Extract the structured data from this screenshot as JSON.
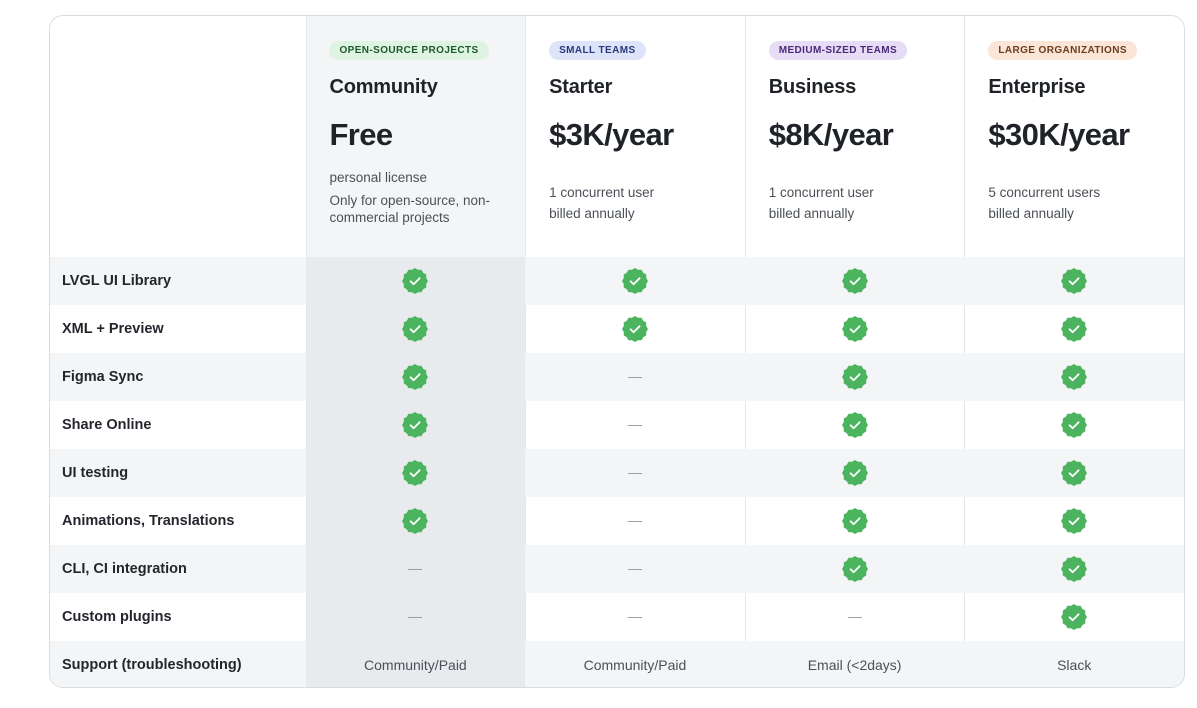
{
  "plans": [
    {
      "badge": "OPEN-SOURCE PROJECTS",
      "badge_bg": "#dff3e3",
      "badge_fg": "#1c5a2c",
      "name": "Community",
      "price": "Free",
      "desc_line1": "personal license",
      "desc_line2": "",
      "note": "Only for open-source, non-commercial projects"
    },
    {
      "badge": "SMALL TEAMS",
      "badge_bg": "#dde3f8",
      "badge_fg": "#2a3a7a",
      "name": "Starter",
      "price": "$3K/year",
      "desc_line1": "1 concurrent user",
      "desc_line2": "billed annually",
      "note": ""
    },
    {
      "badge": "MEDIUM-SIZED TEAMS",
      "badge_bg": "#e6dcf6",
      "badge_fg": "#4a2a78",
      "name": "Business",
      "price": "$8K/year",
      "desc_line1": "1 concurrent user",
      "desc_line2": "billed annually",
      "note": ""
    },
    {
      "badge": "LARGE ORGANIZATIONS",
      "badge_bg": "#fae5d6",
      "badge_fg": "#6b3d1c",
      "name": "Enterprise",
      "price": "$30K/year",
      "desc_line1": "5 concurrent users",
      "desc_line2": "billed annually",
      "note": ""
    }
  ],
  "features": [
    {
      "label": "LVGL UI Library",
      "values": [
        "check",
        "check",
        "check",
        "check"
      ]
    },
    {
      "label": "XML + Preview",
      "values": [
        "check",
        "check",
        "check",
        "check"
      ]
    },
    {
      "label": "Figma Sync",
      "values": [
        "check",
        "dash",
        "check",
        "check"
      ]
    },
    {
      "label": "Share Online",
      "values": [
        "check",
        "dash",
        "check",
        "check"
      ]
    },
    {
      "label": "UI testing",
      "values": [
        "check",
        "dash",
        "check",
        "check"
      ]
    },
    {
      "label": "Animations, Translations",
      "values": [
        "check",
        "dash",
        "check",
        "check"
      ]
    },
    {
      "label": "CLI, CI integration",
      "values": [
        "dash",
        "dash",
        "check",
        "check"
      ]
    },
    {
      "label": "Custom plugins",
      "values": [
        "dash",
        "dash",
        "dash",
        "check"
      ]
    },
    {
      "label": "Support (troubleshooting)",
      "values": [
        "Community/Paid",
        "Community/Paid",
        "Email (<2days)",
        "Slack"
      ]
    }
  ],
  "colors": {
    "check_green": "#4cb35e",
    "check_mark": "#ffffff"
  },
  "icons": {
    "check": "check-badge-icon",
    "dash": "em-dash"
  }
}
